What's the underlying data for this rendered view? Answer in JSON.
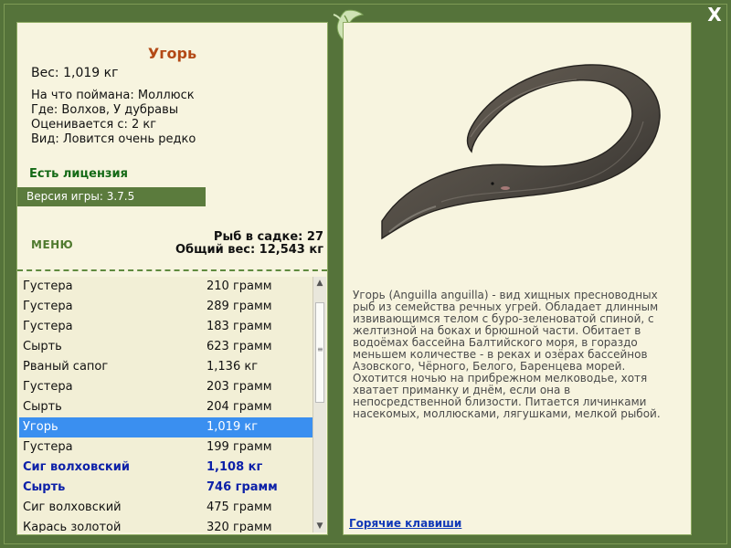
{
  "window": {
    "close_label": "X"
  },
  "left_panel": {
    "fish_title": "Угорь",
    "weight_text": "Вес: 1,019 кг",
    "details": [
      "На что поймана: Моллюск",
      "Где: Волхов, У дубравы",
      "Оценивается с: 2 кг",
      "Вид: Ловится очень редко"
    ],
    "license_text": "Есть лицензия",
    "version_text": "Версия игры: 3.7.5",
    "menu_label": "МЕНЮ",
    "stats": {
      "fish_in_cage": "Рыб в садке: 27",
      "total_weight": "Общий вес: 12,543 кг"
    },
    "fish_list": [
      {
        "name": "Густера",
        "weight": "210 грамм",
        "style": "normal"
      },
      {
        "name": "Густера",
        "weight": "289 грамм",
        "style": "normal"
      },
      {
        "name": "Густера",
        "weight": "183 грамм",
        "style": "normal"
      },
      {
        "name": "Сырть",
        "weight": "623 грамм",
        "style": "normal"
      },
      {
        "name": "Рваный сапог",
        "weight": "1,136 кг",
        "style": "normal"
      },
      {
        "name": "Густера",
        "weight": "203 грамм",
        "style": "normal"
      },
      {
        "name": "Сырть",
        "weight": "204 грамм",
        "style": "normal"
      },
      {
        "name": "Угорь",
        "weight": "1,019 кг",
        "style": "selected"
      },
      {
        "name": "Густера",
        "weight": "199 грамм",
        "style": "normal"
      },
      {
        "name": "Сиг волховский",
        "weight": "1,108 кг",
        "style": "bold"
      },
      {
        "name": "Сырть",
        "weight": "746 грамм",
        "style": "bold"
      },
      {
        "name": "Сиг волховский",
        "weight": "475 грамм",
        "style": "normal"
      },
      {
        "name": "Карась золотой",
        "weight": "320 грамм",
        "style": "normal"
      }
    ]
  },
  "right_panel": {
    "description": "Угорь (Anguilla anguilla) - вид хищных пресноводных рыб из семейства речных угрей. Обладает длинным извивающимся телом с буро-зеленоватой спиной, с желтизной на боках и брюшной части. Обитает в водоёмах бассейна Балтийского моря, в гораздо меньшем количестве - в реках и озёрах бассейнов Азовского, Чёрного, Белого, Баренцева морей. Охотится ночью на прибрежном мелководье, хотя хватает приманку и днём, если она в непосредственной близости. Питается личинками насекомых, моллюсками, лягушками, мелкой рыбой.",
    "hotkeys_label": "Горячие клавиши"
  },
  "colors": {
    "background": "#55733a",
    "panel": "#f7f4df",
    "title": "#b34916",
    "license": "#146a16",
    "selected": "#3a8ff0",
    "bold_row": "#0d21a8",
    "link": "#1139b8"
  }
}
